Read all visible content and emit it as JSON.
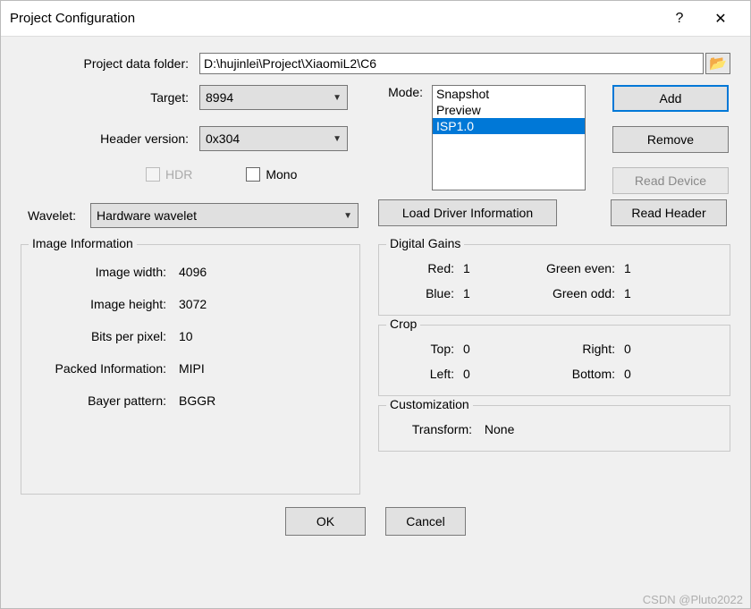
{
  "window": {
    "title": "Project Configuration",
    "help_symbol": "?",
    "close_symbol": "✕"
  },
  "project_folder": {
    "label": "Project data folder:",
    "value": "D:\\hujinlei\\Project\\XiaomiL2\\C6",
    "browse_icon": "📂"
  },
  "target": {
    "label": "Target:",
    "value": "8994"
  },
  "header_version": {
    "label": "Header version:",
    "value": "0x304"
  },
  "checks": {
    "hdr_label": "HDR",
    "mono_label": "Mono"
  },
  "mode": {
    "label": "Mode:",
    "items": [
      "Snapshot",
      "Preview",
      "ISP1.0"
    ],
    "selected_index": 2
  },
  "buttons": {
    "add": "Add",
    "remove": "Remove",
    "read_device": "Read Device",
    "read_header": "Read Header",
    "load_driver": "Load Driver Information",
    "ok": "OK",
    "cancel": "Cancel"
  },
  "wavelet": {
    "label": "Wavelet:",
    "value": "Hardware wavelet"
  },
  "image_info": {
    "legend": "Image Information",
    "width_label": "Image width:",
    "width": "4096",
    "height_label": "Image height:",
    "height": "3072",
    "bpp_label": "Bits per pixel:",
    "bpp": "10",
    "packed_label": "Packed Information:",
    "packed": "MIPI",
    "bayer_label": "Bayer pattern:",
    "bayer": "BGGR"
  },
  "digital_gains": {
    "legend": "Digital Gains",
    "red_label": "Red:",
    "red": "1",
    "green_even_label": "Green even:",
    "green_even": "1",
    "blue_label": "Blue:",
    "blue": "1",
    "green_odd_label": "Green odd:",
    "green_odd": "1"
  },
  "crop": {
    "legend": "Crop",
    "top_label": "Top:",
    "top": "0",
    "right_label": "Right:",
    "right": "0",
    "left_label": "Left:",
    "left": "0",
    "bottom_label": "Bottom:",
    "bottom": "0"
  },
  "customization": {
    "legend": "Customization",
    "transform_label": "Transform:",
    "transform": "None"
  },
  "watermark": "CSDN @Pluto2022"
}
